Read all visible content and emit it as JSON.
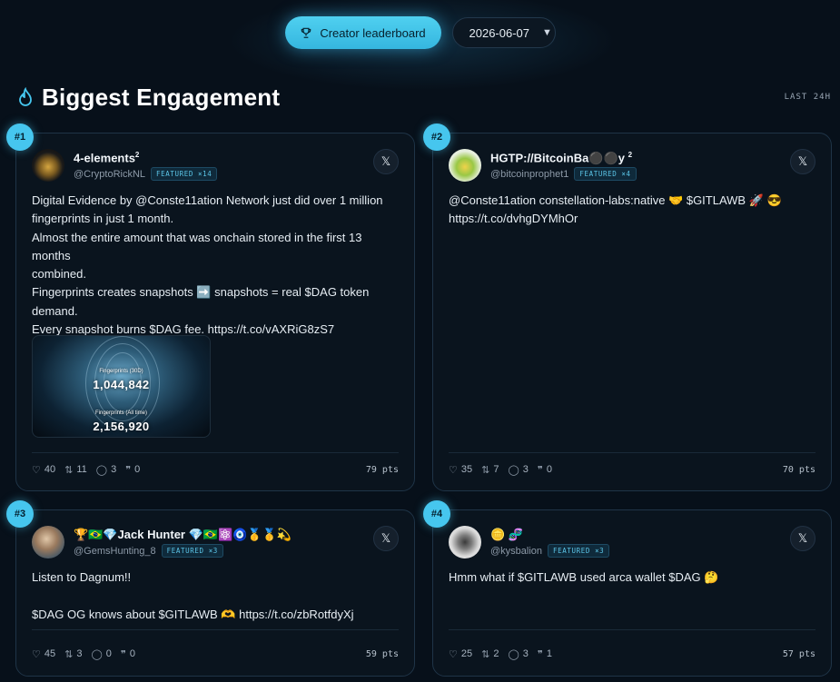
{
  "header": {
    "leaderboard_label": "Creator leaderboard",
    "date_value": "2026-06-07"
  },
  "section": {
    "title": "Biggest Engagement",
    "range": "LAST 24H"
  },
  "colors": {
    "accent": "#46c6ee",
    "background": "#07101a",
    "card_border": "#1f3447"
  },
  "cards": [
    {
      "rank": "#1",
      "name": "4-elements",
      "name_sup": "2",
      "handle": "@CryptoRickNL",
      "featured": "FEATURED ×14",
      "x_label": "𝕏",
      "text_lines": [
        "Digital Evidence by @Conste11ation Network just did over 1 million",
        "fingerprints in just 1 month.",
        "Almost the entire amount that was onchain stored in the first 13 months",
        "combined.",
        "Fingerprints creates snapshots ➡️ snapshots = real $DAG token",
        "demand.",
        "Every snapshot burns $DAG fee. https://t.co/vAXRiG8zS7"
      ],
      "media": {
        "label1": "Fingerprints (30D)",
        "value1": "1,044,842",
        "label2": "Fingerprints (All time)",
        "value2": "2,156,920"
      },
      "likes": "40",
      "reposts": "11",
      "replies": "3",
      "quotes": "0",
      "points": "79 pts"
    },
    {
      "rank": "#2",
      "name": "HGTP://BitcoinBa⚫⚫y",
      "name_sup": "2",
      "handle": "@bitcoinprophet1",
      "featured": "FEATURED ×4",
      "x_label": "𝕏",
      "text_lines": [
        "@Conste11ation constellation-labs:native 🤝 $GITLAWB 🚀 😎",
        "https://t.co/dvhgDYMhOr"
      ],
      "likes": "35",
      "reposts": "7",
      "replies": "3",
      "quotes": "0",
      "points": "70 pts"
    },
    {
      "rank": "#3",
      "name": "🏆🇧🇷💎Jack Hunter 💎🇧🇷⚛️🧿🥇🥇💫",
      "handle": "@GemsHunting_8",
      "featured": "FEATURED ×3",
      "x_label": "𝕏",
      "text_lines": [
        "Listen to Dagnum!!",
        "",
        "$DAG OG knows about $GITLAWB 🫶 https://t.co/zbRotfdyXj"
      ],
      "likes": "45",
      "reposts": "3",
      "replies": "0",
      "quotes": "0",
      "points": "59 pts"
    },
    {
      "rank": "#4",
      "name": "🪙 🧬",
      "handle": "@kysbalion",
      "featured": "FEATURED ×3",
      "x_label": "𝕏",
      "text_lines": [
        "Hmm what if $GITLAWB used arca wallet $DAG 🤔"
      ],
      "likes": "25",
      "reposts": "2",
      "replies": "3",
      "quotes": "1",
      "points": "57 pts"
    }
  ],
  "icons": {
    "trophy": "trophy-icon",
    "chevron": "chevron-down-icon",
    "flame": "flame-icon",
    "like": "heart-icon",
    "repost": "repost-icon",
    "reply": "reply-icon",
    "quote": "quote-icon"
  }
}
